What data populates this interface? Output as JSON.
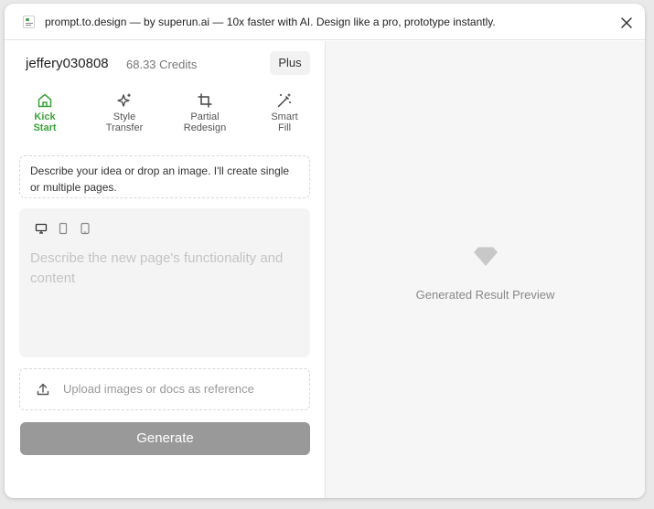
{
  "window": {
    "title": "prompt.to.design — by superun.ai — 10x faster with AI. Design like a pro, prototype instantly."
  },
  "account": {
    "username": "jeffery030808",
    "credits": "68.33 Credits",
    "plan": "Plus"
  },
  "modes": [
    {
      "label": "Kick\nStart",
      "icon": "home-icon",
      "active": true
    },
    {
      "label": "Style\nTransfer",
      "icon": "sparkles-icon",
      "active": false
    },
    {
      "label": "Partial\nRedesign",
      "icon": "crop-icon",
      "active": false
    },
    {
      "label": "Smart\nFill",
      "icon": "magic-wand-icon",
      "active": false
    }
  ],
  "idea_hint": "Describe your idea or drop an image. I'll create single or multiple pages.",
  "prompt": {
    "devices": [
      "desktop-icon",
      "tablet-icon",
      "mobile-icon"
    ],
    "value": "",
    "placeholder": "Describe the new page's functionality and content"
  },
  "upload": {
    "label": "Upload images or docs as reference",
    "icon": "upload-icon"
  },
  "generate": {
    "label": "Generate"
  },
  "preview": {
    "icon": "diamond-icon",
    "label": "Generated Result Preview"
  },
  "colors": {
    "accent": "#3ba33b",
    "generate_button": "#999999",
    "preview_background": "#f6f6f6"
  }
}
